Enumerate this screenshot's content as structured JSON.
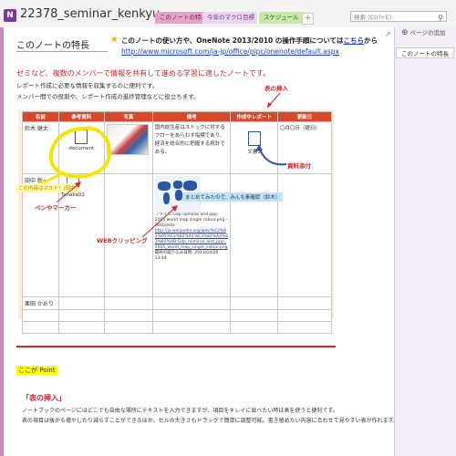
{
  "notebook": {
    "title": "22378_seminar_kenkyu...",
    "icon_letter": "N"
  },
  "tabs": [
    {
      "label": "このノートの特長"
    },
    {
      "label": "今年のマクロ目標"
    },
    {
      "label": "スケジュール"
    }
  ],
  "tab_add": "+",
  "search": {
    "placeholder": "検索 (Ctrl+E)"
  },
  "page": {
    "title": "このノートの特長",
    "info_text": "このノートの使い方や、OneNote 2013/2010 の操作手順については",
    "info_link": "こちら",
    "info_suffix": "から",
    "url": "http://www.microsoft.com/ja-jp/office/pipc/onenote/default.aspx",
    "red_line": "ゼミなど、複数のメンバーで情報を共有して進める学習に適したノートです。",
    "desc1": "レポート作成に必要な情報を収集するのに便利です。",
    "desc2": "メンバー間での役割や、レポート作成の進捗管理などに役立ちます。"
  },
  "table": {
    "headers": [
      "名前",
      "参考資料",
      "写真",
      "備考",
      "作成中レポート",
      "更新日"
    ],
    "rows": [
      {
        "name": "鈴木 健太",
        "ref": "document",
        "memo": "国内総生産はストックに対するフローをあらわす指標であり、経済を総合的に把握する統計である。",
        "report": "文書1",
        "date": "〇月〇日（曜日）"
      },
      {
        "name": "田中 新一",
        "ref": "Tanaka01",
        "memo": "ファイル:Gdp nominal and ppp 2005 world map single colour.png - Wikipedia",
        "link": "http://ja.wikipedia.org/wiki/%E3%83%95%E3%82%A1%E3%82%A4%E3%83%AB:Gdp_nominal_and_ppp_2005_world_map_single_colour.png",
        "link_date": "最終の取り込み日時: 2013/04/26 13:44"
      },
      {
        "name": "栗田 かおり"
      }
    ]
  },
  "annotations": {
    "table_insert": "表の挿入",
    "file_attach": "資料添付",
    "pen_marker": "ペンやマーカー",
    "web_clip": "WEBクリッピング",
    "yellow_note": "この内容はマスト！(田中)",
    "blue_note": "まとめてみたので、みんな素確認（鈴木）"
  },
  "point_label": "ここが Point",
  "section": {
    "heading": "「表の挿入」",
    "body1": "ノートブックのページにはどこでも自由な場所にテキストを入力できますが、項目をキレイに並べたい時は表を使うと便利です。",
    "body2": "表の項目は後から増やしたり減らすことができるほか、セルの大きさもドラッグで簡単に調整可能。書き留めたい内容に合わせて見やすい表が作れます。",
    "body3": ""
  },
  "right_panel": {
    "add_page": "ページの追加",
    "pages": [
      "このノートの特長"
    ]
  },
  "colors": {
    "accent": "#d5492a",
    "annotation": "#d8262b",
    "tab1": "#e8a2c9",
    "tab3": "#c9e8a8"
  }
}
